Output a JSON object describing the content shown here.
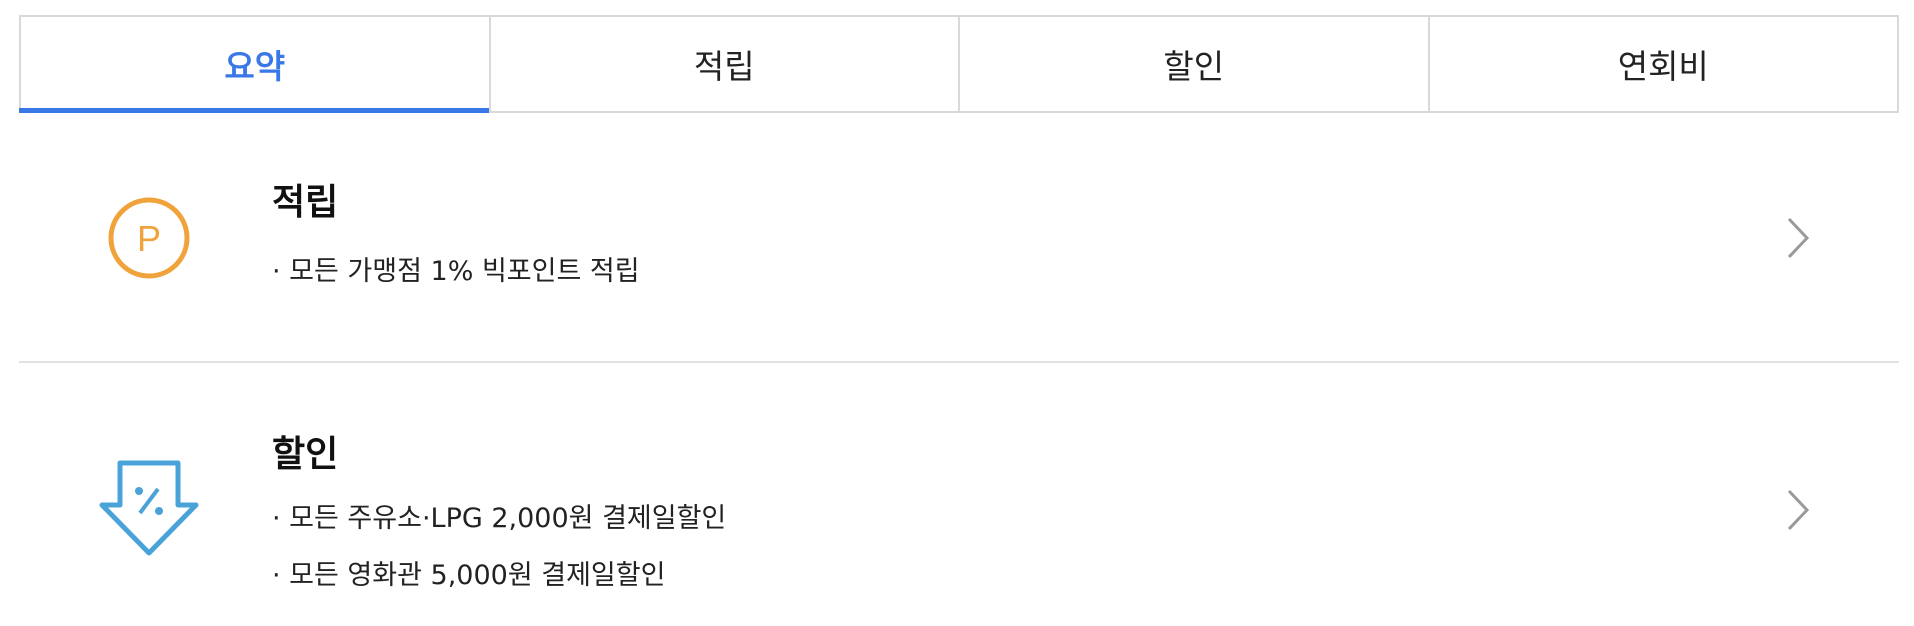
{
  "tabs": [
    {
      "label": "요약",
      "active": true
    },
    {
      "label": "적립",
      "active": false
    },
    {
      "label": "할인",
      "active": false
    },
    {
      "label": "연회비",
      "active": false
    }
  ],
  "benefits": [
    {
      "icon": "point-circle-icon",
      "title": "적립",
      "items": [
        "· 모든 가맹점 1% 빅포인트 적립"
      ]
    },
    {
      "icon": "discount-arrow-icon",
      "title": "할인",
      "items": [
        "· 모든 주유소·LPG 2,000원 결제일할인",
        "· 모든 영화관 5,000원 결제일할인"
      ]
    }
  ],
  "colors": {
    "accent": "#3b78e7",
    "point_icon": "#f0a23b",
    "discount_icon": "#4aa3d8",
    "chevron": "#9a9a9a",
    "divider": "#e2e2e2"
  }
}
